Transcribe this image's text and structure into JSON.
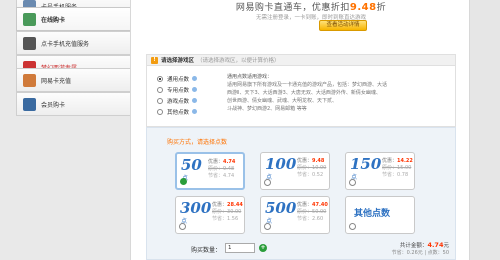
{
  "sidebar": {
    "items": [
      {
        "label": "卡号手机服务",
        "icon": "card-phone-icon",
        "color": "#6a8ab0"
      },
      {
        "label": "在线购卡",
        "icon": "shopping-icon",
        "color": "#4a9a5a"
      },
      {
        "label": "点卡手机充值服务",
        "icon": "phone-icon",
        "color": "#555555"
      },
      {
        "label": "梦幻西游专属",
        "icon": "game-icon",
        "color": "#cc3333"
      },
      {
        "label": "网易卡充值",
        "icon": "card-icon",
        "color": "#d07a3a"
      },
      {
        "label": "会员购卡",
        "icon": "member-icon",
        "color": "#3a6aa0"
      }
    ]
  },
  "header": {
    "headline_prefix": "网易购卡直通车，优惠折扣",
    "headline_accent": "9.48",
    "headline_suffix": "折",
    "subline": "无需注册登录，一卡到账，即时到账直达游戏",
    "promo_button": "查看活动详情"
  },
  "region": {
    "label": "请选择游戏区",
    "note": "（请选择游戏区，以便计算价格）",
    "options": [
      {
        "label": "通用点数",
        "selected": true
      },
      {
        "label": "专用点数",
        "selected": false
      },
      {
        "label": "游戏点数",
        "selected": false
      },
      {
        "label": "其他点数",
        "selected": false
      }
    ],
    "info_title": "通用点数适用游戏：",
    "info_lines": [
      "适用网易旗下所有游戏及一卡通充值的游戏产品，包括：梦幻西游、大话",
      "西游Ⅱ、天下3、大话西游3、大唐无双、大话西游外传、新倩女幽魂、",
      "创世西游、倩女幽魂、武魂、大明龙权、天下贰、",
      "斗战神、梦幻西游2、网易邮箱 等等"
    ]
  },
  "purchase": {
    "title": "购买方式，请选择点数",
    "cards": [
      {
        "points": "50",
        "unit": "点",
        "price": "4.74",
        "price_label": "优惠：",
        "orig_label": "原价：",
        "orig": "9.48",
        "save_label": "节省：",
        "save": "4.74",
        "selected": true
      },
      {
        "points": "100",
        "unit": "点",
        "price": "9.48",
        "price_label": "优惠：",
        "orig_label": "原价：",
        "orig": "10.00",
        "save_label": "节省：",
        "save": "0.52",
        "selected": false
      },
      {
        "points": "150",
        "unit": "点",
        "price": "14.22",
        "price_label": "优惠：",
        "orig_label": "原价：",
        "orig": "15.00",
        "save_label": "节省：",
        "save": "0.78",
        "selected": false
      },
      {
        "points": "300",
        "unit": "点",
        "price": "28.44",
        "price_label": "优惠：",
        "orig_label": "原价：",
        "orig": "30.00",
        "save_label": "节省：",
        "save": "1.56",
        "selected": false
      },
      {
        "points": "500",
        "unit": "点",
        "price": "47.40",
        "price_label": "优惠：",
        "orig_label": "原价：",
        "orig": "50.00",
        "save_label": "节省：",
        "save": "2.60",
        "selected": false
      }
    ],
    "other_label": "其他点数",
    "qty_label": "购买数量：",
    "qty_value": "1",
    "total_label": "共计金额：",
    "total_amount": "4.74",
    "total_unit": "元",
    "total_sub": "节省：0.26元 | 点数：50"
  },
  "colors": {
    "accent": "#ff7200",
    "price_red": "#ff3300",
    "link_blue": "#2e72c2",
    "check_green": "#2a9d3a"
  }
}
